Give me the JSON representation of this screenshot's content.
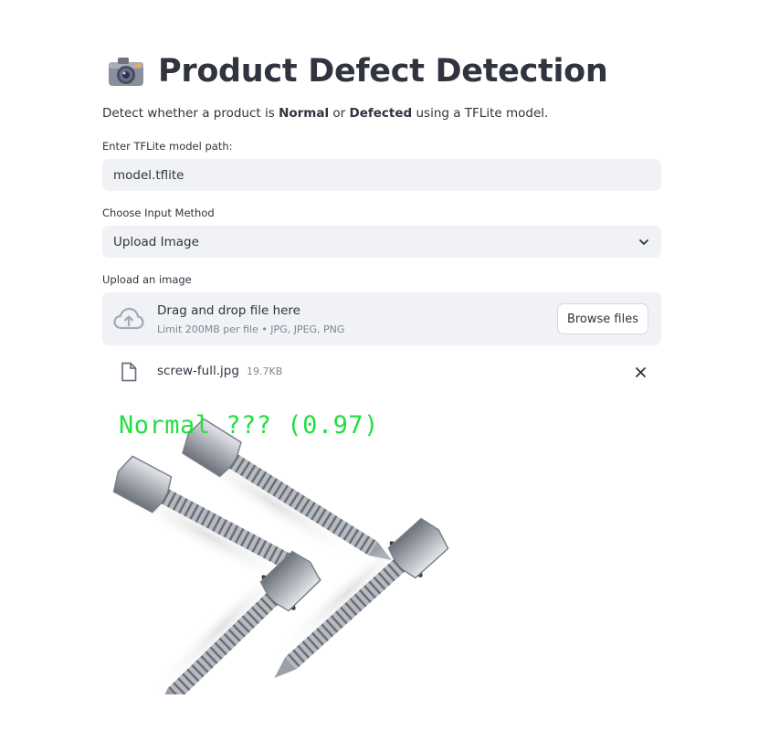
{
  "header": {
    "title": "Product Defect Detection",
    "icon": "camera-icon"
  },
  "intro": {
    "pre": "Detect whether a product is ",
    "bold1": "Normal",
    "mid": " or ",
    "bold2": "Defected",
    "post": " using a TFLite model."
  },
  "model_path": {
    "label": "Enter TFLite model path:",
    "value": "model.tflite"
  },
  "input_method": {
    "label": "Choose Input Method",
    "selected": "Upload Image"
  },
  "uploader": {
    "label": "Upload an image",
    "drag_text": "Drag and drop file here",
    "limit_text": "Limit 200MB per file • JPG, JPEG, PNG",
    "browse_label": "Browse files"
  },
  "uploaded_file": {
    "name": "screw-full.jpg",
    "size": "19.7KB"
  },
  "result_image": {
    "overlay_text": "Normal ??? (0.97)",
    "overlay_color": "#20e040"
  },
  "colors": {
    "input_bg": "#f0f2f6",
    "text": "#31333f",
    "muted": "#808495"
  }
}
